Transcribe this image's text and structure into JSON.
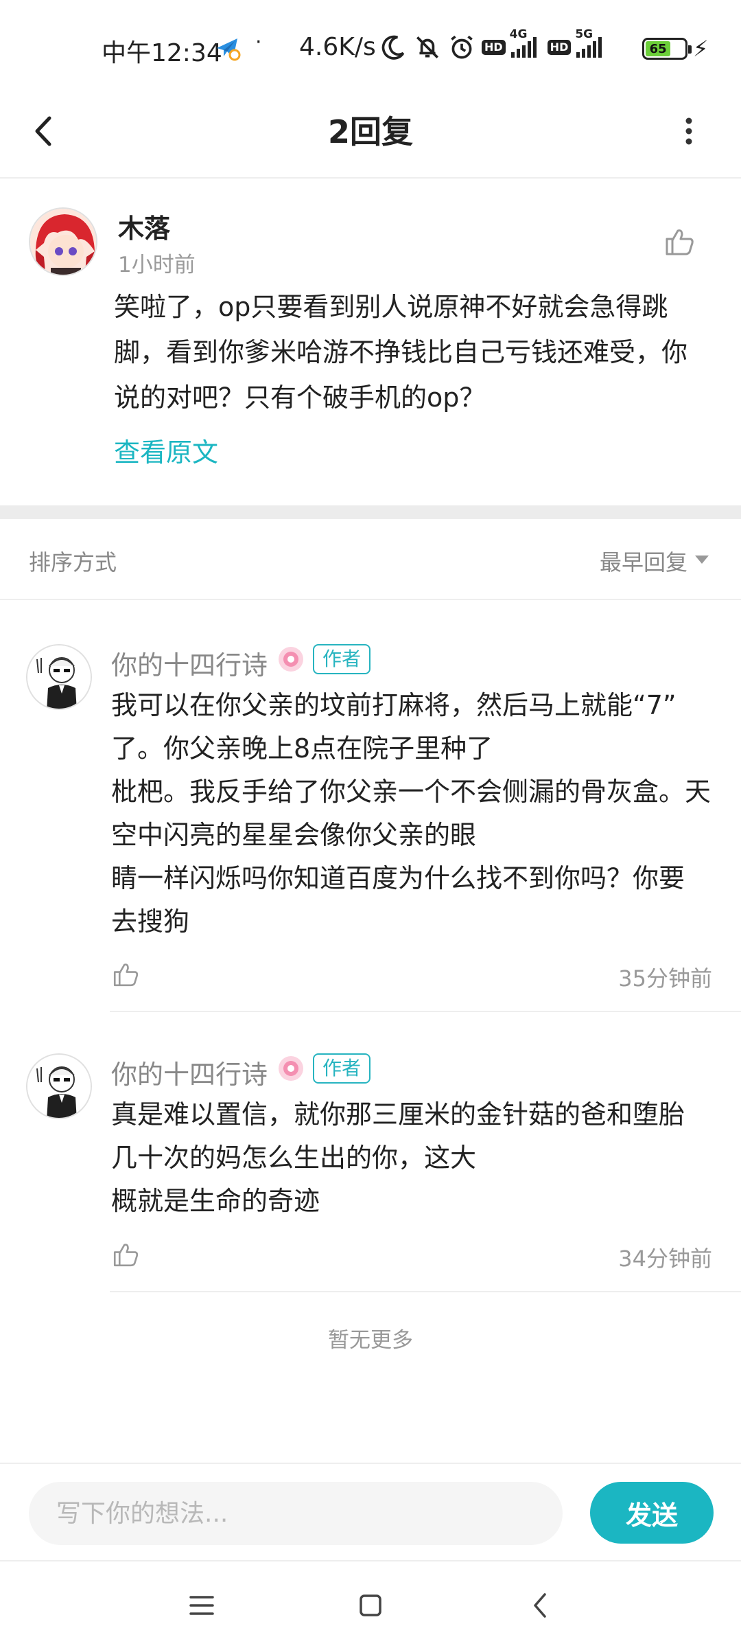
{
  "status_bar": {
    "time": "中午12:34",
    "dot": "·",
    "net_speed": "4.6K/s",
    "hd_label": "HD",
    "net1": "4G",
    "net2": "5G",
    "battery": "65",
    "charging_icon": "bolt-icon"
  },
  "header": {
    "title": "2回复",
    "back_icon": "back-arrow-icon",
    "more_icon": "more-vertical-icon"
  },
  "original_post": {
    "author": "木落",
    "time": "1小时前",
    "content": "笑啦了，op只要看到别人说原神不好就会急得跳脚，看到你爹米哈游不挣钱比自己亏钱还难受，你说的对吧？只有个破手机的op？",
    "view_original": "查看原文"
  },
  "sort": {
    "label": "排序方式",
    "value": "最早回复"
  },
  "replies": [
    {
      "author": "你的十四行诗",
      "author_tag": "作者",
      "lines": [
        "我可以在你父亲的坟前打麻将，然后马上就能“7”",
        "了。你父亲晚上8点在院子里种了",
        "枇杷。我反手给了你父亲一个不会侧漏的骨灰盒。天",
        "空中闪亮的星星会像你父亲的眼",
        "睛一样闪烁吗你知道百度为什么找不到你吗？你要",
        "去搜狗"
      ],
      "time": "35分钟前"
    },
    {
      "author": "你的十四行诗",
      "author_tag": "作者",
      "lines": [
        "真是难以置信，就你那三厘米的金针菇的爸和堕胎",
        "几十次的妈怎么生出的你，这大",
        "概就是生命的奇迹"
      ],
      "time": "34分钟前"
    }
  ],
  "no_more": "暂无更多",
  "input": {
    "placeholder": "写下你的想法...",
    "send_label": "发送"
  },
  "colors": {
    "accent": "#1bb6c2",
    "text_primary": "#222222",
    "text_secondary": "#999999",
    "divider": "#eeeeee"
  }
}
